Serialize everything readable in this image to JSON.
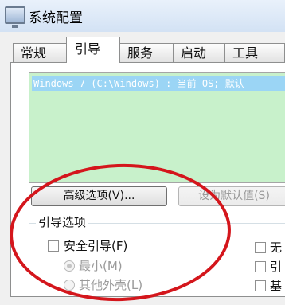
{
  "window": {
    "title": "系统配置",
    "icon": "msconfig-window-icon"
  },
  "tabs": [
    {
      "label": "常规",
      "active": false
    },
    {
      "label": "引导",
      "active": true
    },
    {
      "label": "服务",
      "active": false
    },
    {
      "label": "启动",
      "active": false
    },
    {
      "label": "工具",
      "active": false
    }
  ],
  "os_list": {
    "selected_entry": "Windows 7 (C:\\Windows) : 当前 OS; 默认"
  },
  "buttons": {
    "advanced": "高级选项(V)...",
    "set_default": "设为默认值(S)"
  },
  "boot_options": {
    "group_title": "引导选项",
    "safe_boot": "安全引导(F)",
    "minimal": "最小(M)",
    "alternate_shell": "其他外壳(L)"
  },
  "right_options": {
    "item1": "无",
    "item2": "引",
    "item3": "基"
  },
  "colors": {
    "annotation": "#d4161c",
    "list_bg": "#c8f1cb",
    "selection": "#9bd5f5"
  }
}
